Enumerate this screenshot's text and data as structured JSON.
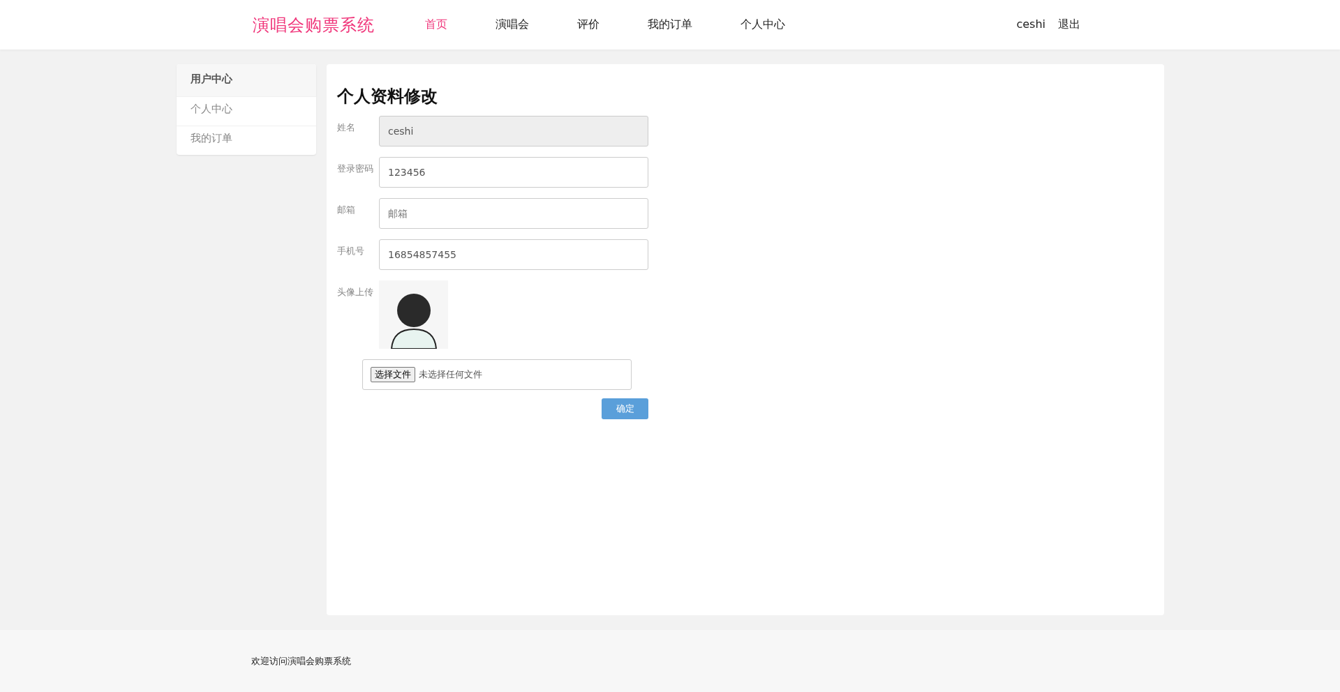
{
  "header": {
    "logo": "演唱会购票系统",
    "nav": [
      {
        "label": "首页",
        "selected": true
      },
      {
        "label": "演唱会",
        "selected": false
      },
      {
        "label": "评价",
        "selected": false
      },
      {
        "label": "我的订单",
        "selected": false
      },
      {
        "label": "个人中心",
        "selected": false
      }
    ],
    "user": "ceshi",
    "logout": "退出"
  },
  "sidebar": {
    "title": "用户中心",
    "items": [
      {
        "label": "个人中心"
      },
      {
        "label": "我的订单"
      }
    ]
  },
  "form": {
    "title": "个人资料修改",
    "fields": [
      {
        "label": "姓名",
        "value": "ceshi",
        "disabled": true
      },
      {
        "label": "登录密码",
        "value": "123456",
        "disabled": false
      },
      {
        "label": "邮箱",
        "placeholder": "邮箱",
        "disabled": false
      },
      {
        "label": "手机号",
        "value": "16854857455",
        "disabled": false
      }
    ],
    "avatar": {
      "label": "头像上传",
      "file_button": "选择文件",
      "file_status": "未选择任何文件"
    },
    "submit": "确定"
  },
  "footer": {
    "text": "欢迎访问演唱会购票系统"
  }
}
